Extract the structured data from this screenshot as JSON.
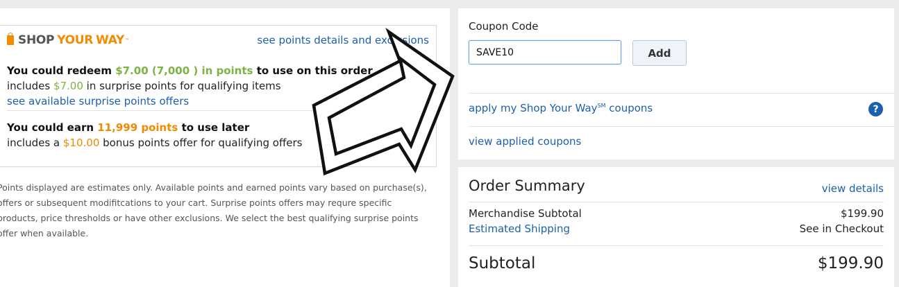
{
  "points_card": {
    "logo": {
      "shop": "SHOP",
      "your": "YOUR",
      "way": "WAY",
      "tm": "™"
    },
    "points_link": "see points details and exclusions",
    "redeem": {
      "prefix": "You could redeem ",
      "amount": "$7.00 (7,000 ) in points",
      "suffix": " to use on this order",
      "line2_prefix": "includes ",
      "line2_amount": "$7.00",
      "line2_suffix": " in surprise points for qualifying items",
      "offers_link": "see available surprise points offers"
    },
    "earn": {
      "prefix": "You could earn ",
      "amount": "11,999 points",
      "suffix": " to use later",
      "line2_prefix": "includes a ",
      "line2_amount": "$10.00",
      "line2_suffix": " bonus points offer for qualifying offers"
    }
  },
  "disclaimer": "Points displayed are estimates only. Available points and earned points vary based on purchase(s), offers or subsequent modifitcations to your cart. Surprise points offers may requre specific products, price thresholds or have other exclusions. We select the best qualifying surprise points offer when available.",
  "coupon": {
    "label": "Coupon Code",
    "value": "SAVE10",
    "add_label": "Add",
    "apply_link": "apply my Shop Your Way",
    "apply_sup": "SM",
    "apply_suffix": " coupons",
    "help": "?",
    "applied_link": "view applied coupons"
  },
  "order_summary": {
    "title": "Order Summary",
    "view_details": "view details",
    "merch_label": "Merchandise Subtotal",
    "merch_value": "$199.90",
    "ship_label": "Estimated Shipping",
    "ship_value": "See in Checkout",
    "subtotal_label": "Subtotal",
    "subtotal_value": "$199.90"
  }
}
